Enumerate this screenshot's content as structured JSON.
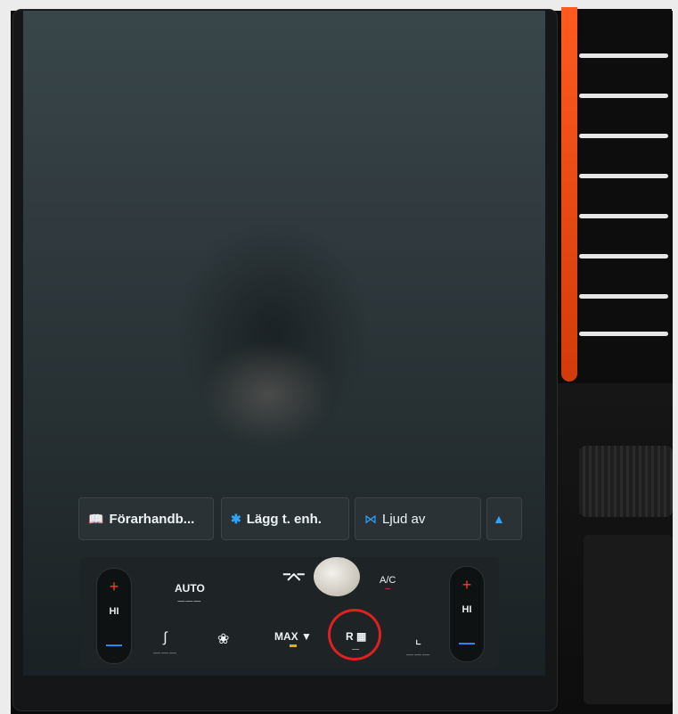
{
  "shortcuts": {
    "manual_label": "Förarhandb...",
    "bluetooth_label": "Lägg t. enh.",
    "mute_label": "Ljud av"
  },
  "climate": {
    "auto_label": "AUTO",
    "ac_label": "A/C",
    "left_fan_level": "HI",
    "right_fan_level": "HI",
    "max_defrost_label": "MAX",
    "rear_defrost_label": "R"
  },
  "colors": {
    "accent_blue": "#2fa3ff",
    "increase_red": "#ff3b30",
    "decrease_blue": "#2f8cff",
    "active_amber": "#f2a900",
    "grille_orange": "#ff5a1f"
  }
}
